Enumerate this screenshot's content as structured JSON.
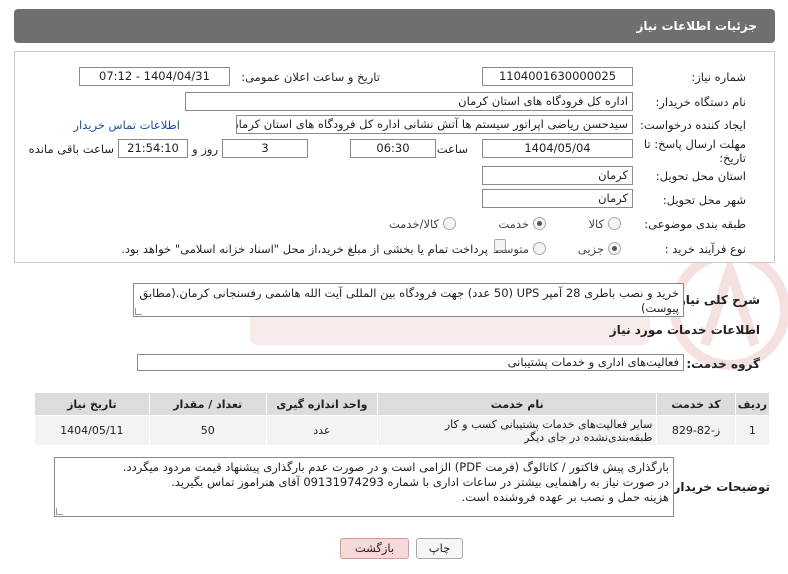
{
  "header": {
    "title": "جزئیات اطلاعات نیاز"
  },
  "form": {
    "need_number_label": "شماره نیاز:",
    "need_number": "1104001630000025",
    "announce_label": "تاریخ و ساعت اعلان عمومی:",
    "announce_value": "1404/04/31 - 07:12",
    "buyer_org_label": "نام دستگاه خریدار:",
    "buyer_org": "اداره کل فرودگاه های استان کرمان",
    "creator_label": "ایجاد کننده درخواست:",
    "creator": "سیدحسن ریاضی اپراتور سیستم ها آتش نشانی اداره کل فرودگاه های استان کرمان",
    "contact_link": "اطلاعات تماس خریدار",
    "deadline_label_1": "مهلت ارسال پاسخ: تا",
    "deadline_label_2": "تاریخ:",
    "deadline_date": "1404/05/04",
    "time_label": "ساعت",
    "deadline_time": "06:30",
    "days_value": "3",
    "days_label": "روز و",
    "remain_time": "21:54:10",
    "remain_label": "ساعت باقی مانده",
    "province_label": "استان محل تحویل:",
    "province": "کرمان",
    "city_label": "شهر محل تحویل:",
    "city": "کرمان",
    "category_label": "طبقه بندی موضوعی:",
    "category_options": [
      "کالا",
      "خدمت",
      "کالا/خدمت"
    ],
    "category_selected": "خدمت",
    "process_label": "نوع فرآیند خرید :",
    "process_options": [
      "جزیی",
      "متوسط"
    ],
    "process_selected": "جزیی",
    "payment_note": "پرداخت تمام یا بخشی از مبلغ خرید،از محل \"اسناد خزانه اسلامی\" خواهد بود."
  },
  "summary": {
    "label": "شرح کلی نیاز:",
    "text": "خرید و نصب باطری 28 آمپر  UPS (50 عدد) جهت فرودگاه بین المللی آیت الله هاشمی رفسنجانی کرمان.(مطابق پیوست)"
  },
  "services": {
    "section_title": "اطلاعات خدمات مورد نیاز",
    "group_label": "گروه خدمت:",
    "group_value": "فعالیت‌های اداری و خدمات پشتیبانی",
    "table": {
      "headers": [
        "ردیف",
        "کد خدمت",
        "نام خدمت",
        "واحد اندازه گیری",
        "تعداد / مقدار",
        "تاریخ نیاز"
      ],
      "rows": [
        [
          "1",
          "ز-82-829",
          "سایر فعالیت‌های خدمات پشتیبانی کسب و کار طبقه‌بندی‌نشده در جای دیگر",
          "عدد",
          "50",
          "1404/05/11"
        ]
      ]
    }
  },
  "buyer_notes": {
    "label": "توضیحات خریدار:",
    "line1": "بارگذاری پیش فاکتور / کاتالوگ (فرمت PDF) الزامی است و در صورت عدم بارگذاری پیشنهاد قیمت مردود میگردد.",
    "line2": "در صورت نیاز به راهنمایی بیشتر در ساعات اداری با شماره 09131974293 آقای هنراموز  تماس بگیرید.",
    "line3": "هزینه حمل و نصب بر عهده فروشنده است."
  },
  "buttons": {
    "print": "چاپ",
    "back": "بازگشت"
  },
  "colors": {
    "header_bg": "#6f6f6f",
    "link": "#1f4ea8",
    "back_btn": "#f7d9d9"
  }
}
